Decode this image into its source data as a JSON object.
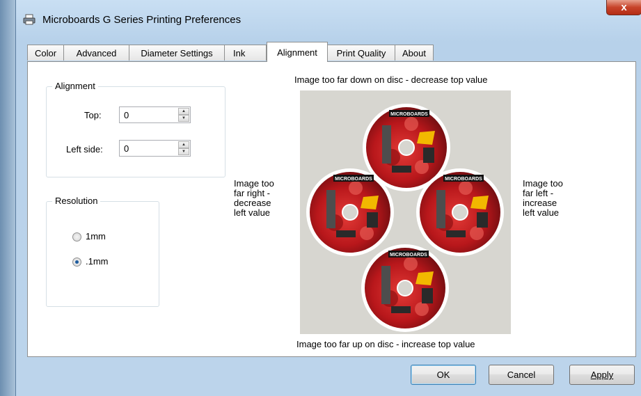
{
  "window": {
    "title": "Microboards G Series Printing Preferences",
    "close_label": "x"
  },
  "tabs": [
    {
      "label": "Color"
    },
    {
      "label": "Advanced"
    },
    {
      "label": "Diameter Settings"
    },
    {
      "label": "Ink"
    },
    {
      "label": "Alignment"
    },
    {
      "label": "Print Quality"
    },
    {
      "label": "About"
    }
  ],
  "active_tab": "Alignment",
  "alignment_group": {
    "title": "Alignment",
    "top_label": "Top:",
    "top_value": "0",
    "left_label": "Left side:",
    "left_value": "0"
  },
  "resolution_group": {
    "title": "Resolution",
    "options": [
      {
        "label": "1mm",
        "checked": false
      },
      {
        "label": ".1mm",
        "checked": true
      }
    ]
  },
  "hints": {
    "top": "Image too far down on disc - decrease top value",
    "bottom": "Image too far up on disc - increase top value",
    "left_lines": [
      "Image too",
      "far right -",
      "decrease",
      "left value"
    ],
    "right_lines": [
      "Image too",
      "far left -",
      "increase",
      "left value"
    ]
  },
  "disc_logo_text": "MICROBOARDS",
  "buttons": {
    "ok": "OK",
    "cancel": "Cancel",
    "apply": "Apply"
  },
  "colors": {
    "disc_red": "#c81e22",
    "panel_gray": "#d7d6d0",
    "radio_selected": "#1d5b9e"
  }
}
